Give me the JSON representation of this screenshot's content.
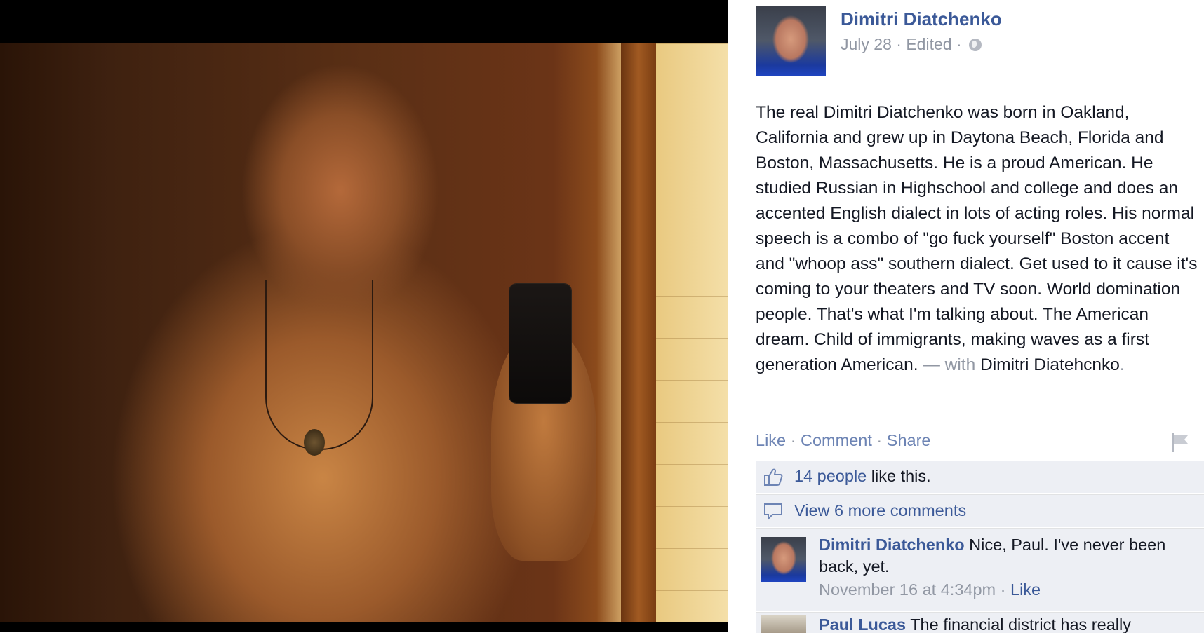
{
  "post": {
    "author": "Dimitri Diatchenko",
    "date": "July 28",
    "edited": "Edited",
    "privacy_icon": "globe-icon",
    "text": "The real Dimitri Diatchenko was born in Oakland, California and grew up in Daytona Beach, Florida and Boston, Massachusetts. He is a proud American. He studied Russian in Highschool and college and does an accented English dialect in lots of acting roles. His normal speech is a combo of \"go fuck yourself\" Boston accent and \"whoop ass\" southern dialect. Get used to it cause it's coming to your theaters and TV soon. World domination people. That's what I'm talking about. The American dream. Child of immigrants, making waves as a first generation American.",
    "with_separator": "— with",
    "tagged_name": "Dimitri Diatehcnko",
    "tag_period": "."
  },
  "actions": {
    "like": "Like",
    "comment": "Comment",
    "share": "Share",
    "separator": "·"
  },
  "likes": {
    "count_link": "14 people",
    "suffix": "like this."
  },
  "more_comments": "View 6 more comments",
  "comments": [
    {
      "author": "Dimitri Diatchenko",
      "text": "Nice, Paul. I've never been back, yet.",
      "timestamp": "November 16 at 4:34pm",
      "like": "Like"
    },
    {
      "author": "Paul Lucas",
      "text": "The financial district has really"
    }
  ],
  "colors": {
    "link_blue": "#3b5998",
    "meta_gray": "#9197a3",
    "ufi_background": "#edeff4"
  }
}
